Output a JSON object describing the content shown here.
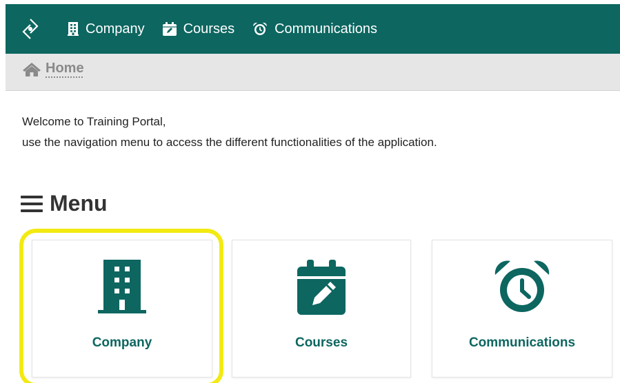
{
  "colors": {
    "brand": "#0d6660",
    "breadcrumb_bg": "#e6e6e6",
    "highlight": "#f2ea12"
  },
  "navbar": {
    "logo_icon": "company-logo-icon",
    "items": [
      {
        "label": "Company",
        "icon": "building-icon"
      },
      {
        "label": "Courses",
        "icon": "calendar-edit-icon"
      },
      {
        "label": "Communications",
        "icon": "alarm-clock-icon"
      }
    ]
  },
  "breadcrumb": {
    "icon": "home-icon",
    "label": "Home"
  },
  "welcome": {
    "line1": "Welcome to Training Portal,",
    "line2": "use the navigation menu to access the different functionalities of the application."
  },
  "menu": {
    "title": "Menu",
    "icon": "hamburger-icon",
    "cards": [
      {
        "label": "Company",
        "icon": "building-icon"
      },
      {
        "label": "Courses",
        "icon": "calendar-edit-icon"
      },
      {
        "label": "Communications",
        "icon": "alarm-clock-icon"
      }
    ]
  }
}
